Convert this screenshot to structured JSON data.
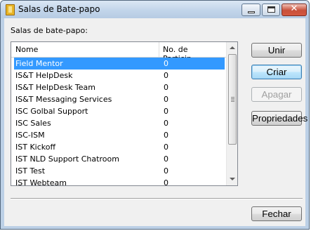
{
  "window": {
    "title": "Salas de Bate-papo"
  },
  "rooms_label": "Salas de bate-papo:",
  "columns": {
    "name": "Nome",
    "count": "No. de Particip..."
  },
  "rooms": [
    {
      "name": "Field Mentor",
      "count": "0",
      "selected": true
    },
    {
      "name": "IS&T HelpDesk",
      "count": "0"
    },
    {
      "name": "IS&T HelpDesk Team",
      "count": "0"
    },
    {
      "name": "IS&T Messaging Services",
      "count": "0"
    },
    {
      "name": "ISC Golbal Support",
      "count": "0"
    },
    {
      "name": "ISC Sales",
      "count": "0"
    },
    {
      "name": "ISC-ISM",
      "count": "0"
    },
    {
      "name": "IST Kickoff",
      "count": "0"
    },
    {
      "name": "IST NLD Support Chatroom",
      "count": "0"
    },
    {
      "name": "IST Test",
      "count": "0"
    },
    {
      "name": "IST Webteam",
      "count": "0"
    }
  ],
  "buttons": {
    "join": "Unir",
    "create": "Criar",
    "delete": "Apagar",
    "properties": "Propriedades",
    "close": "Fechar"
  },
  "icons": {
    "app": "chat-app-icon",
    "minimize": "minimize-icon",
    "maximize": "maximize-icon",
    "close": "close-icon"
  }
}
